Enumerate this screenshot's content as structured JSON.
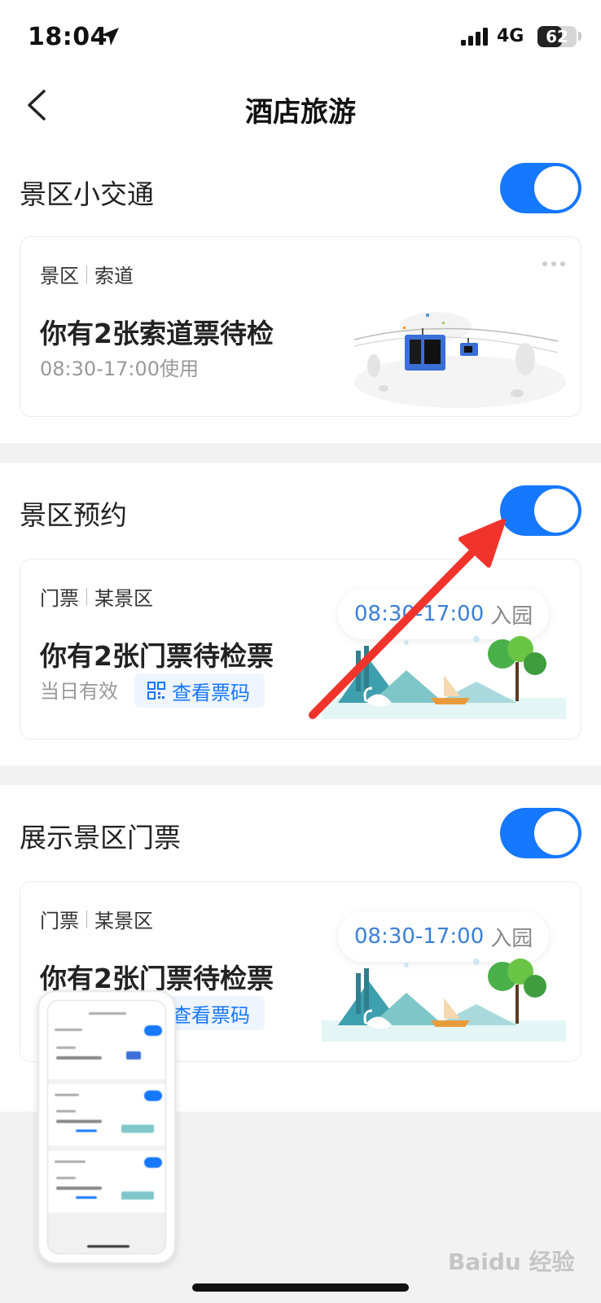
{
  "status_bar": {
    "time": "18:04",
    "network": "4G",
    "battery_level": 62,
    "battery_text": "62"
  },
  "nav": {
    "title": "酒店旅游"
  },
  "sections": [
    {
      "title": "景区小交通",
      "enabled": true,
      "card": {
        "tag1": "景区",
        "tag2": "索道",
        "title": "你有2张索道票待检",
        "subtitle": "08:30-17:00使用"
      }
    },
    {
      "title": "景区预约",
      "enabled": true,
      "card": {
        "tag1": "门票",
        "tag2": "某景区",
        "title": "你有2张门票待检票",
        "subtitle": "当日有效",
        "action_label": "查看票码",
        "bubble_time": "08:30-17:00",
        "bubble_entry": "入园"
      }
    },
    {
      "title": "展示景区门票",
      "enabled": true,
      "card": {
        "tag1": "门票",
        "tag2": "某景区",
        "title": "你有2张门票待检票",
        "action_label": "查看票码",
        "bubble_time": "08:30-17:00",
        "bubble_entry": "入园"
      }
    }
  ],
  "watermark": "Baidu 经验",
  "colors": {
    "accent": "#1677ff",
    "annotation_arrow": "#f0342c"
  }
}
